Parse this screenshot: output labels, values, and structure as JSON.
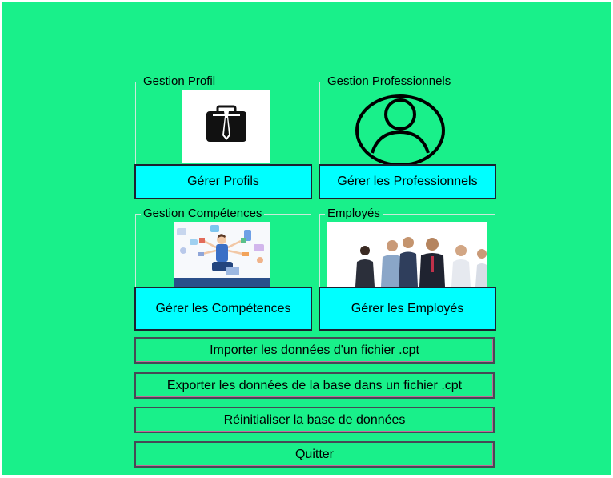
{
  "groups": {
    "profil": {
      "title": "Gestion Profil",
      "button": "Gérer Profils",
      "icon": "briefcase-icon"
    },
    "professionnels": {
      "title": "Gestion Professionnels",
      "button": "Gérer les Professionnels",
      "icon": "user-circle-icon"
    },
    "competences": {
      "title": "Gestion Compétences",
      "button": "Gérer les Compétences",
      "icon": "multitasking-illustration"
    },
    "employes": {
      "title": "Employés",
      "button": "Gérer les Employés",
      "icon": "team-photo"
    }
  },
  "actions": {
    "import": "Importer les données d'un fichier .cpt",
    "export": "Exporter les données de la base dans un fichier .cpt",
    "reset": "Réinitialiser la base de données",
    "quit": "Quitter"
  },
  "colors": {
    "background": "#19f08a",
    "button": "#00ffff"
  }
}
